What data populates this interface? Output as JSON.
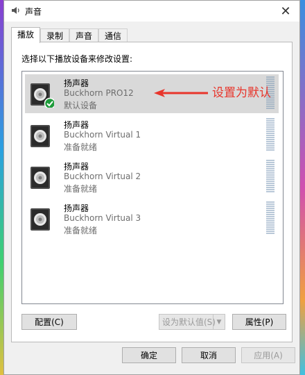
{
  "window": {
    "title": "声音",
    "close_glyph": "✕"
  },
  "tabs": [
    {
      "label": "播放",
      "active": true
    },
    {
      "label": "录制",
      "active": false
    },
    {
      "label": "声音",
      "active": false
    },
    {
      "label": "通信",
      "active": false
    }
  ],
  "instruction": "选择以下播放设备来修改设置:",
  "devices": [
    {
      "name": "扬声器",
      "model": "Buckhorn PRO12",
      "status": "默认设备",
      "selected": true,
      "default": true
    },
    {
      "name": "扬声器",
      "model": "Buckhorn Virtual 1",
      "status": "准备就绪",
      "selected": false,
      "default": false
    },
    {
      "name": "扬声器",
      "model": "Buckhorn Virtual 2",
      "status": "准备就绪",
      "selected": false,
      "default": false
    },
    {
      "name": "扬声器",
      "model": "Buckhorn Virtual 3",
      "status": "准备就绪",
      "selected": false,
      "default": false
    }
  ],
  "annotation": {
    "text": "设置为默认",
    "color": "#e8352b"
  },
  "buttons": {
    "configure": "配置(C)",
    "set_default": "设为默认值(S)",
    "properties": "属性(P)",
    "ok": "确定",
    "cancel": "取消",
    "apply": "应用(A)"
  },
  "icons": {
    "window": "speaker-icon",
    "device": "speaker-box-icon",
    "default_badge": "checkmark-icon",
    "dropdown": "chevron-down-icon"
  },
  "colors": {
    "selection": "#d9d9d9",
    "default_badge": "#1e9b3a"
  }
}
